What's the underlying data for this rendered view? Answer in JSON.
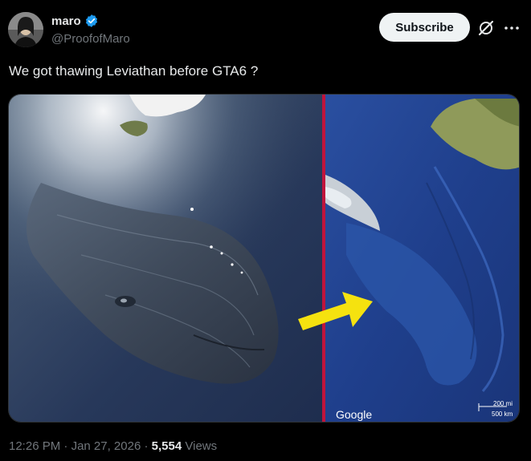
{
  "author": {
    "display_name": "maro",
    "handle": "@ProofofMaro",
    "verified": true
  },
  "actions": {
    "subscribe_label": "Subscribe"
  },
  "tweet": {
    "text": "We got thawing Leviathan before GTA6 ?"
  },
  "media": {
    "map_watermark": "Google",
    "scale_top": "200 mi",
    "scale_bottom": "500 km"
  },
  "meta": {
    "time": "12:26 PM",
    "separator": "·",
    "date": "Jan 27, 2026",
    "views_count": "5,554",
    "views_label": "Views"
  },
  "colors": {
    "background": "#000000",
    "verified_badge": "#1d9bf0",
    "subscribe_bg": "#eff3f4",
    "divider_line": "#c0143c",
    "arrow": "#f5e20f"
  }
}
